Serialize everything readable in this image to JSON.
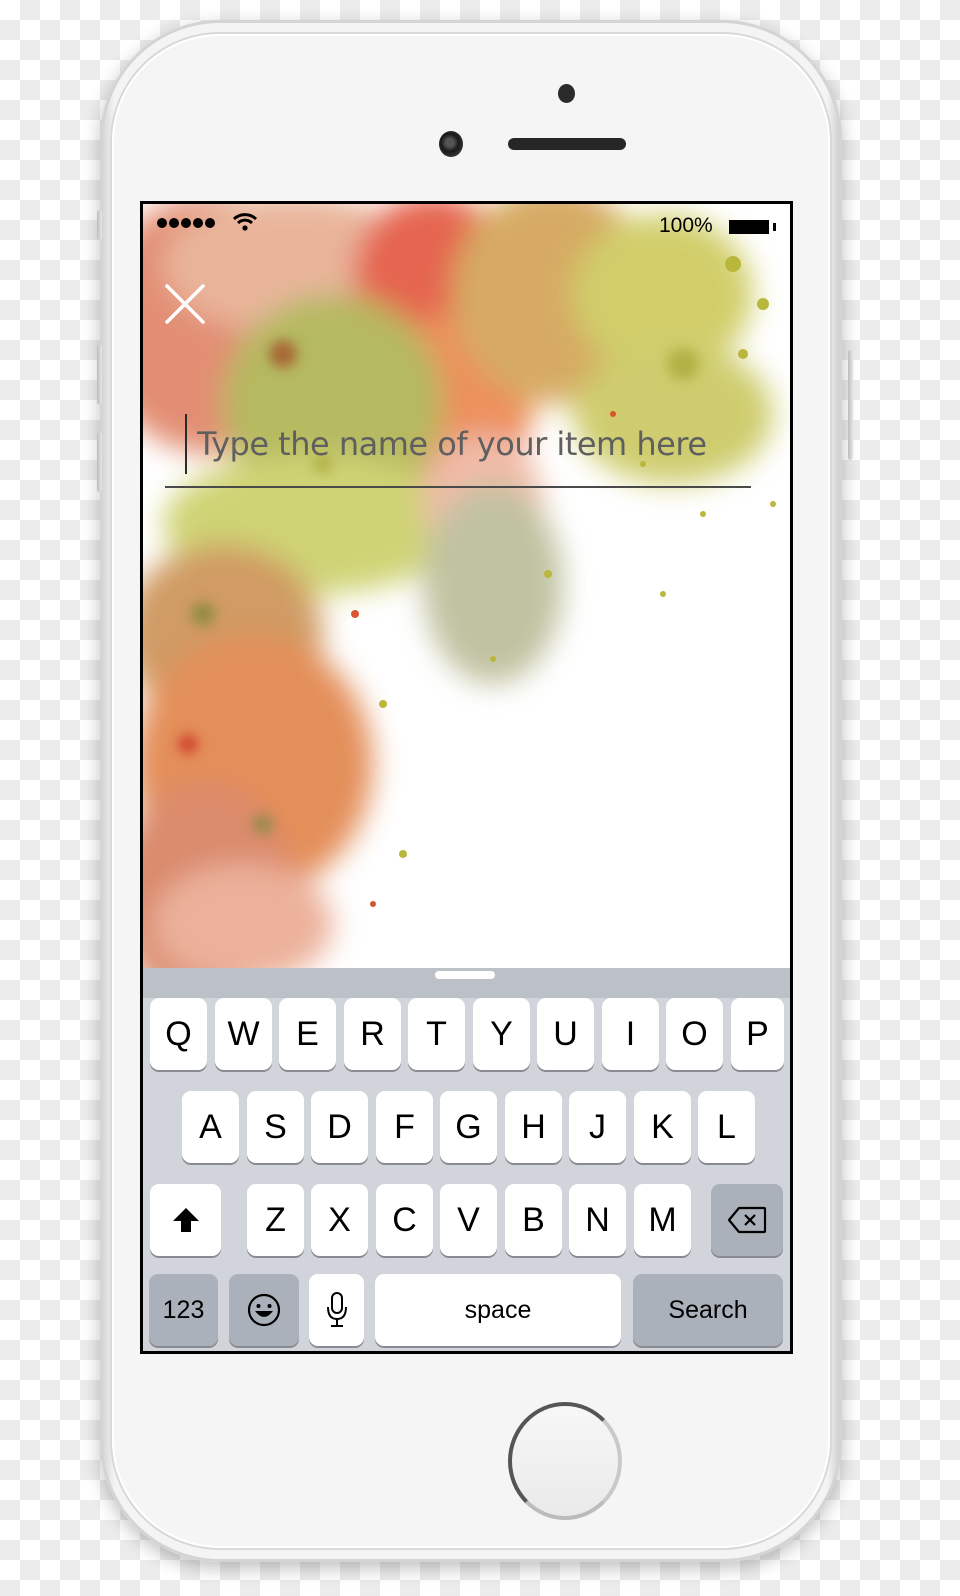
{
  "status_bar": {
    "signal_dots": 5,
    "wifi_icon": "wifi-icon",
    "battery_percent": "100%",
    "battery_level": 1.0
  },
  "header": {
    "close_icon": "close-icon"
  },
  "item_input": {
    "value": "",
    "placeholder": "Type the name of your item here"
  },
  "keyboard": {
    "row1": [
      "Q",
      "W",
      "E",
      "R",
      "T",
      "Y",
      "U",
      "I",
      "O",
      "P"
    ],
    "row2": [
      "A",
      "S",
      "D",
      "F",
      "G",
      "H",
      "J",
      "K",
      "L"
    ],
    "row3": [
      "Z",
      "X",
      "C",
      "V",
      "B",
      "N",
      "M"
    ],
    "shift_icon": "shift-icon",
    "backspace_icon": "backspace-icon",
    "numbers_label": "123",
    "emoji_icon": "emoji-icon",
    "mic_icon": "microphone-icon",
    "space_label": "space",
    "search_label": "Search"
  },
  "colors": {
    "key_background": "#ffffff",
    "function_key_background": "#abb1ba",
    "keyboard_background": "#d1d5db",
    "placeholder_text": "#5f5f5f",
    "watercolor_palette": [
      "#e0533a",
      "#e98a4c",
      "#c9c44a",
      "#b7b98e",
      "#e7a184"
    ]
  }
}
